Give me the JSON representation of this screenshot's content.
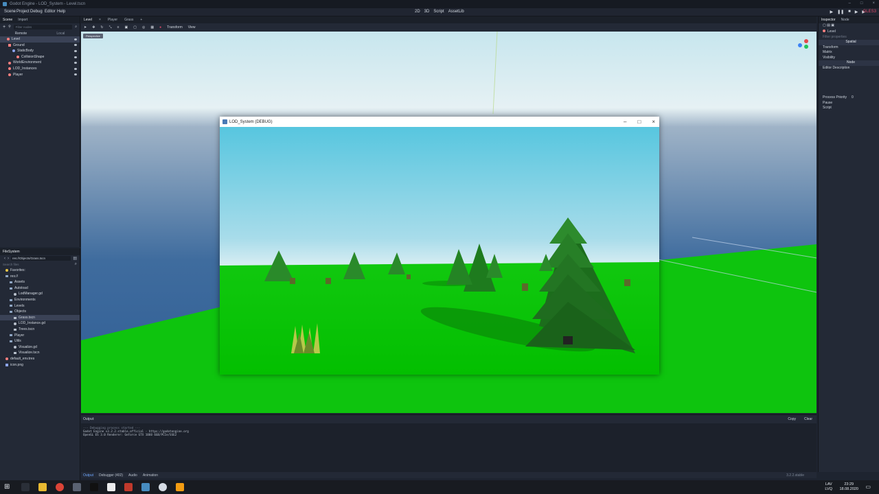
{
  "window": {
    "title": "Godot Engine - LOD_System - Level.tscn"
  },
  "menu": [
    "Scene",
    "Project",
    "Debug",
    "Editor",
    "Help"
  ],
  "modes": [
    "2D",
    "3D",
    "Script",
    "AssetLib"
  ],
  "renderer": "GLES3",
  "scene_dock": {
    "tabs": [
      "Scene",
      "Import"
    ],
    "filter_placeholder": "Filter nodes",
    "remote": "Remote",
    "local": "Local",
    "nodes": [
      "Level",
      "Ground",
      "StaticBody",
      "CollisionShape",
      "WorldEnvironment",
      "LOD_Instances",
      "Player"
    ]
  },
  "filesystem": {
    "title": "FileSystem",
    "path": "res://Objects/Grass.tscn",
    "search_placeholder": "Search files",
    "items": [
      "Favorites:",
      "res://",
      "Assets",
      "Autoload",
      "LodManager.gd",
      "Environments",
      "Levels",
      "Objects",
      "Grass.tscn",
      "LOD_Instance.gd",
      "Trees.tscn",
      "Player",
      "Utils",
      "Visualize.gd",
      "Visualize.tscn",
      "default_env.tres",
      "icon.png"
    ]
  },
  "editor_tabs": [
    "Level",
    "Player",
    "Grass"
  ],
  "toolbar": {
    "transform": "Transform",
    "view": "View"
  },
  "viewport": {
    "perspective": "Perspective"
  },
  "game_window": {
    "title": "LOD_System (DEBUG)"
  },
  "inspector": {
    "tabs": [
      "Inspector",
      "Node"
    ],
    "node": "Level",
    "filter_placeholder": "Filter properties",
    "section": "Spatial",
    "props": [
      "Transform",
      "Matrix",
      "Visibility"
    ],
    "category": "Node",
    "editor_desc": "Editor Description",
    "process_priority": "Process Priority",
    "process_value": "0",
    "pause": "Pause",
    "script": "Script"
  },
  "output": {
    "label": "Output:",
    "copy": "Copy",
    "clear": "Clear",
    "lines": [
      "--- Debugging process started ---",
      "Godot Engine v3.2.2.stable.official - https://godotengine.org",
      "OpenGL ES 3.0 Renderer: GeForce GTX 1060 6GB/PCIe/SSE2"
    ],
    "version": "3.2.2.stable"
  },
  "bottom_tabs": [
    "Output",
    "Debugger (402)",
    "Audio",
    "Animation"
  ],
  "tray": {
    "lang": "LAV",
    "lang2": "LVQ",
    "time": "23:29",
    "date": "18.08.2020"
  },
  "colors": {
    "accent": "#6fa8ff",
    "renderer": "#e0496a",
    "ground": "#00c000",
    "sky_top": "#5ac8e0"
  }
}
